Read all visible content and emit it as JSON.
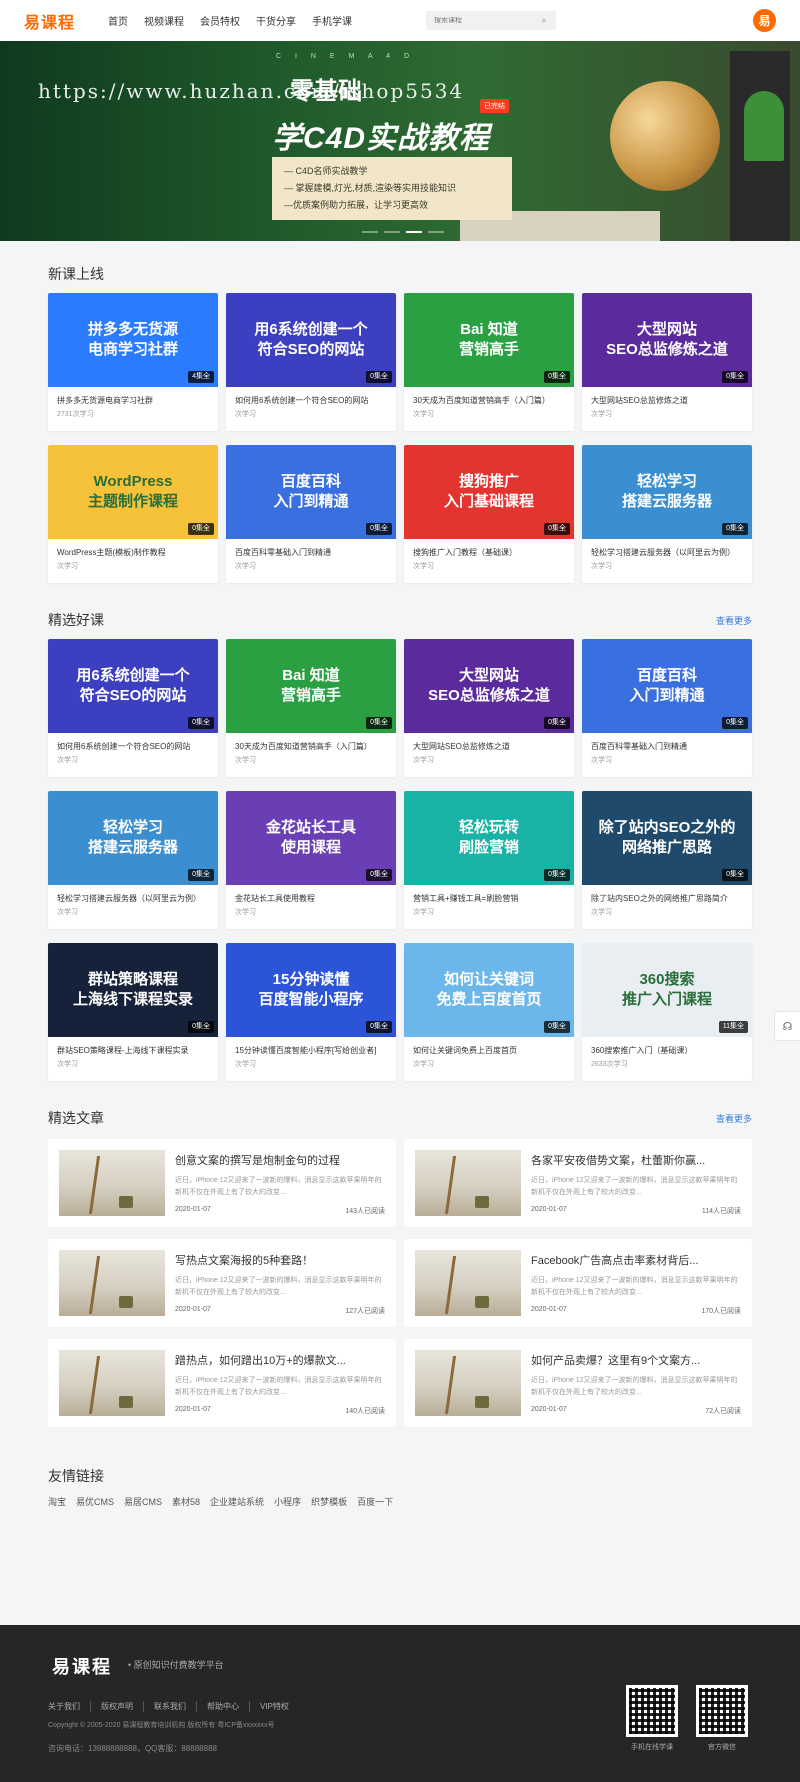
{
  "header": {
    "logo": "易课程",
    "nav": [
      "首页",
      "视频课程",
      "会员特权",
      "干货分享",
      "手机学课"
    ],
    "search_placeholder": "搜索课程",
    "avatar": "易"
  },
  "banner": {
    "subtitle": "C I N E M A 4 D",
    "zero": "零基础",
    "tag": "已完结",
    "title": "学C4D实战教程",
    "points": [
      "— C4D名师实战教学",
      "— 掌握建模,灯光,材质,渲染等实用技能知识",
      "—优质案例助力拓展，让学习更高效"
    ],
    "watermark": "https://www.huzhan.com/ishop5534"
  },
  "new_courses": {
    "heading": "新课上线",
    "items": [
      {
        "thumb": "拼多多无货源\n电商学习社群",
        "badge": "4集全",
        "title": "拼多多无货源电商学习社群",
        "meta": "2731次学习",
        "bg": "#2b7bff"
      },
      {
        "thumb": "用6系统创建一个\n符合SEO的网站",
        "badge": "0集全",
        "title": "如何用6系统创建一个符合SEO的网站",
        "meta": "次学习",
        "bg": "#3c3fbf"
      },
      {
        "thumb": "Bai 知道\n营销高手",
        "badge": "0集全",
        "title": "30天成为百度知道营销高手（入门篇）",
        "meta": "次学习",
        "bg": "#2aa042"
      },
      {
        "thumb": "大型网站\nSEO总监修炼之道",
        "badge": "0集全",
        "title": "大型网站SEO总监修炼之道",
        "meta": "次学习",
        "bg": "#5b2b9e"
      },
      {
        "thumb": "WordPress\n主题制作课程",
        "badge": "0集全",
        "title": "WordPress主题(模板)制作教程",
        "meta": "次学习",
        "bg": "#f5c23a"
      },
      {
        "thumb": "百度百科\n入门到精通",
        "badge": "0集全",
        "title": "百度百科零基础入门到精通",
        "meta": "次学习",
        "bg": "#3a6fe0"
      },
      {
        "thumb": "搜狗推广\n入门基础课程",
        "badge": "0集全",
        "title": "搜狗推广入门教程（基础课）",
        "meta": "次学习",
        "bg": "#e3342f"
      },
      {
        "thumb": "轻松学习\n搭建云服务器",
        "badge": "0集全",
        "title": "轻松学习搭建云服务器（以阿里云为例）",
        "meta": "次学习",
        "bg": "#3b8fd0"
      }
    ]
  },
  "featured_courses": {
    "heading": "精选好课",
    "more": "查看更多",
    "items": [
      {
        "thumb": "用6系统创建一个\n符合SEO的网站",
        "badge": "0集全",
        "title": "如何用6系统创建一个符合SEO的网站",
        "meta": "次学习",
        "bg": "#3c3fbf"
      },
      {
        "thumb": "Bai 知道\n营销高手",
        "badge": "0集全",
        "title": "30天成为百度知道营销高手（入门篇）",
        "meta": "次学习",
        "bg": "#2aa042"
      },
      {
        "thumb": "大型网站\nSEO总监修炼之道",
        "badge": "0集全",
        "title": "大型网站SEO总监修炼之道",
        "meta": "次学习",
        "bg": "#5b2b9e"
      },
      {
        "thumb": "百度百科\n入门到精通",
        "badge": "0集全",
        "title": "百度百科零基础入门到精通",
        "meta": "次学习",
        "bg": "#3a6fe0"
      },
      {
        "thumb": "轻松学习\n搭建云服务器",
        "badge": "0集全",
        "title": "轻松学习搭建云服务器（以阿里云为例）",
        "meta": "次学习",
        "bg": "#3b8fd0"
      },
      {
        "thumb": "金花站长工具\n使用课程",
        "badge": "0集全",
        "title": "金花站长工具使用教程",
        "meta": "次学习",
        "bg": "#6a3fb5"
      },
      {
        "thumb": "轻松玩转\n刷脸营销",
        "badge": "0集全",
        "title": "营销工具+赚钱工具=刷脸营销",
        "meta": "次学习",
        "bg": "#19b3a6"
      },
      {
        "thumb": "除了站内SEO之外的\n网络推广思路",
        "badge": "0集全",
        "title": "除了站内SEO之外的网络推广思路简介",
        "meta": "次学习",
        "bg": "#1f4a6b"
      },
      {
        "thumb": "群站策略课程\n上海线下课程实录",
        "badge": "0集全",
        "title": "群站SEO策略课程-上海线下课程实录",
        "meta": "次学习",
        "bg": "#16213a"
      },
      {
        "thumb": "15分钟读懂\n百度智能小程序",
        "badge": "0集全",
        "title": "15分钟读懂百度智能小程序[写给创业者]",
        "meta": "次学习",
        "bg": "#2c54d8"
      },
      {
        "thumb": "如何让关键词\n免费上百度首页",
        "badge": "0集全",
        "title": "如何让关键词免费上百度首页",
        "meta": "次学习",
        "bg": "#6bb6ea"
      },
      {
        "thumb": "360搜索\n推广入门课程",
        "badge": "11集全",
        "title": "360搜索推广入门（基础课）",
        "meta": "2633次学习",
        "bg": "#e9eef2"
      }
    ]
  },
  "articles": {
    "heading": "精选文章",
    "more": "查看更多",
    "desc": "近日，iPhone 12又迎来了一波新的爆料，消息显示这款苹果明年的新机不仅在外观上有了较大的改变...",
    "items": [
      {
        "title": "创意文案的撰写是炮制金句的过程",
        "date": "2020-01-07",
        "reads": "143人已阅读"
      },
      {
        "title": "各家平安夜借势文案，杜蕾斯你赢...",
        "date": "2020-01-07",
        "reads": "114人已阅读"
      },
      {
        "title": "写热点文案海报的5种套路！",
        "date": "2020-01-07",
        "reads": "127人已阅读"
      },
      {
        "title": "Facebook广告高点击率素材背后...",
        "date": "2020-01-07",
        "reads": "170人已阅读"
      },
      {
        "title": "蹭热点，如何蹭出10万+的爆款文...",
        "date": "2020-01-07",
        "reads": "140人已阅读"
      },
      {
        "title": "如何产品卖爆？这里有9个文案方...",
        "date": "2020-01-07",
        "reads": "72人已阅读"
      }
    ]
  },
  "friend_links": {
    "heading": "友情链接",
    "items": [
      "淘宝",
      "易优CMS",
      "易居CMS",
      "素材58",
      "企业建站系统",
      "小程序",
      "织梦模板",
      "百度一下"
    ]
  },
  "footer": {
    "logo": "易课程",
    "slogan": "• 原创知识付费教学平台",
    "links": [
      "关于我们",
      "版权声明",
      "联系我们",
      "帮助中心",
      "VIP特权"
    ],
    "copyright": "Copyright © 2005-2020 易课程教育培训机构 版权所有 粤ICP备xxxxxxx号",
    "contact": "咨询电话：13988888888，QQ客服：88888888",
    "qr_captions": [
      "手机在线学课",
      "官方微信"
    ]
  },
  "side": {
    "cs_icon": "headset-icon"
  }
}
